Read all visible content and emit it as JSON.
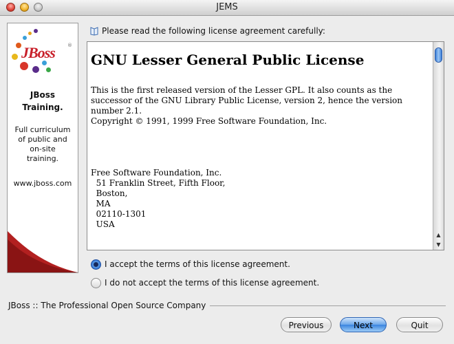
{
  "window": {
    "title": "JEMS"
  },
  "sidebar": {
    "logo_text": "JBoss",
    "heading": "JBoss\nTraining.",
    "description": "Full curriculum\nof public and\non-site\ntraining.",
    "url": "www.jboss.com",
    "colors": {
      "brand_red": "#c8202a"
    }
  },
  "instruction": "Please read the following license agreement carefully:",
  "license": {
    "title": "GNU Lesser General Public License",
    "paragraph1": "This is the first released version of the Lesser GPL. It also counts as the successor of the GNU Library Public License, version 2, hence the version number 2.1.",
    "copyright": "Copyright © 1991, 1999 Free Software Foundation, Inc.",
    "address": "Free Software Foundation, Inc.\n  51 Franklin Street, Fifth Floor,\n  Boston,\n  MA\n  02110-1301\n  USA"
  },
  "options": {
    "accept": {
      "label": "I accept the terms of this license agreement.",
      "selected": true
    },
    "decline": {
      "label": "I do not accept the terms of this license agreement.",
      "selected": false
    }
  },
  "footer": {
    "company": "JBoss :: The Professional Open Source Company"
  },
  "buttons": {
    "previous": "Previous",
    "next": "Next",
    "quit": "Quit"
  },
  "icons": {
    "instruction_icon": "book-icon"
  }
}
